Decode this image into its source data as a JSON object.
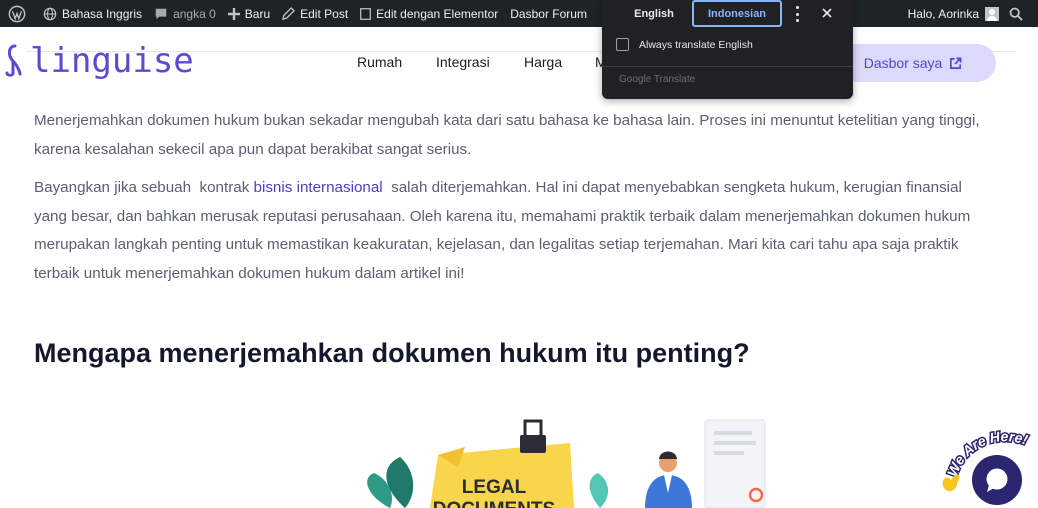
{
  "admin_bar": {
    "language": "Bahasa Inggris",
    "comments": "angka 0",
    "new": "Baru",
    "edit_post": "Edit Post",
    "edit_elementor": "Edit dengan Elementor",
    "forum": "Dasbor Forum",
    "greeting": "Halo, Aorinka"
  },
  "header": {
    "logo": "linguise",
    "nav": [
      "Rumah",
      "Integrasi",
      "Harga",
      "M"
    ],
    "dashboard_button": "Dasbor saya"
  },
  "translate_popup": {
    "tab_source": "English",
    "tab_target": "Indonesian",
    "always_translate": "Always translate English",
    "brand": "Google Translate"
  },
  "article": {
    "p1": "Menerjemahkan dokumen hukum bukan sekadar mengubah kata dari satu bahasa ke bahasa lain. Proses ini menuntut ketelitian yang tinggi, karena kesalahan sekecil apa pun dapat berakibat sangat serius.",
    "p2_before": "Bayangkan jika sebuah  kontrak ",
    "p2_link": "bisnis internasional",
    "p2_after": "  salah diterjemahkan. Hal ini dapat menyebabkan sengketa hukum, kerugian finansial yang besar, dan bahkan merusak reputasi perusahaan. Oleh karena itu, memahami praktik terbaik dalam menerjemahkan dokumen hukum merupakan langkah penting untuk memastikan keakuratan, kejelasan, dan legalitas setiap terjemahan. Mari kita cari tahu apa saja praktik terbaik untuk menerjemahkan dokumen hukum dalam artikel ini!",
    "heading": "Mengapa menerjemahkan dokumen hukum itu penting?",
    "illustration_text_1": "LEGAL",
    "illustration_text_2": "DOCUMENTS"
  },
  "chat": {
    "label": "We Are Here!"
  },
  "colors": {
    "accent": "#5a4ad1",
    "admin_bg": "#1d2327",
    "popup_bg": "#202124",
    "popup_active": "#8ab4f8"
  }
}
